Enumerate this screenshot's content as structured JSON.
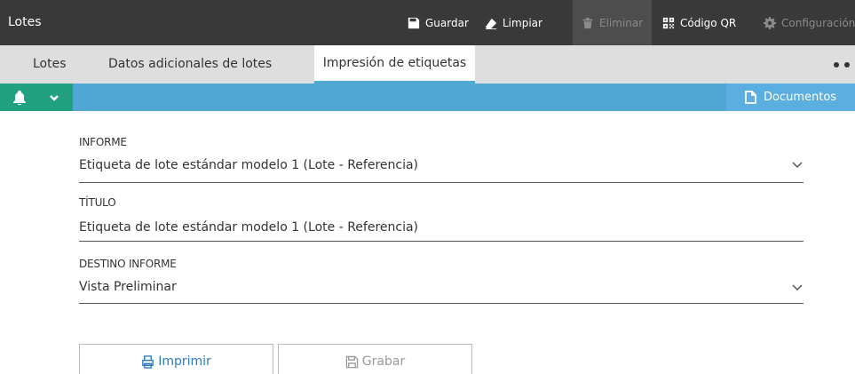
{
  "app": {
    "title": "Lotes"
  },
  "toolbar": {
    "guardar": "Guardar",
    "limpiar": "Limpiar",
    "eliminar": "Eliminar",
    "codigo_qr": "Código QR",
    "configuracion": "Configuración"
  },
  "tabs": [
    {
      "label": "Lotes"
    },
    {
      "label": "Datos adicionales de lotes"
    },
    {
      "label": "Impresión de etiquetas"
    }
  ],
  "active_tab": "Impresión de etiquetas",
  "bluebar": {
    "documentos": "Documentos"
  },
  "form": {
    "informe": {
      "label": "INFORME",
      "value": "Etiqueta de lote estándar modelo 1 (Lote - Referencia)"
    },
    "titulo": {
      "label": "TÍTULO",
      "value": "Etiqueta de lote estándar modelo 1 (Lote - Referencia)"
    },
    "destino": {
      "label": "DESTINO INFORME",
      "value": "Vista Preliminar"
    }
  },
  "actions": {
    "imprimir": "Imprimir",
    "grabar": "Grabar"
  },
  "colors": {
    "topbar": "#393939",
    "tabs_bg": "#dedede",
    "tab_active_underline": "#4fa9d6",
    "bluebar": "#51a7d4",
    "help_green": "#22a082",
    "print_blue": "#2f7bbf"
  }
}
